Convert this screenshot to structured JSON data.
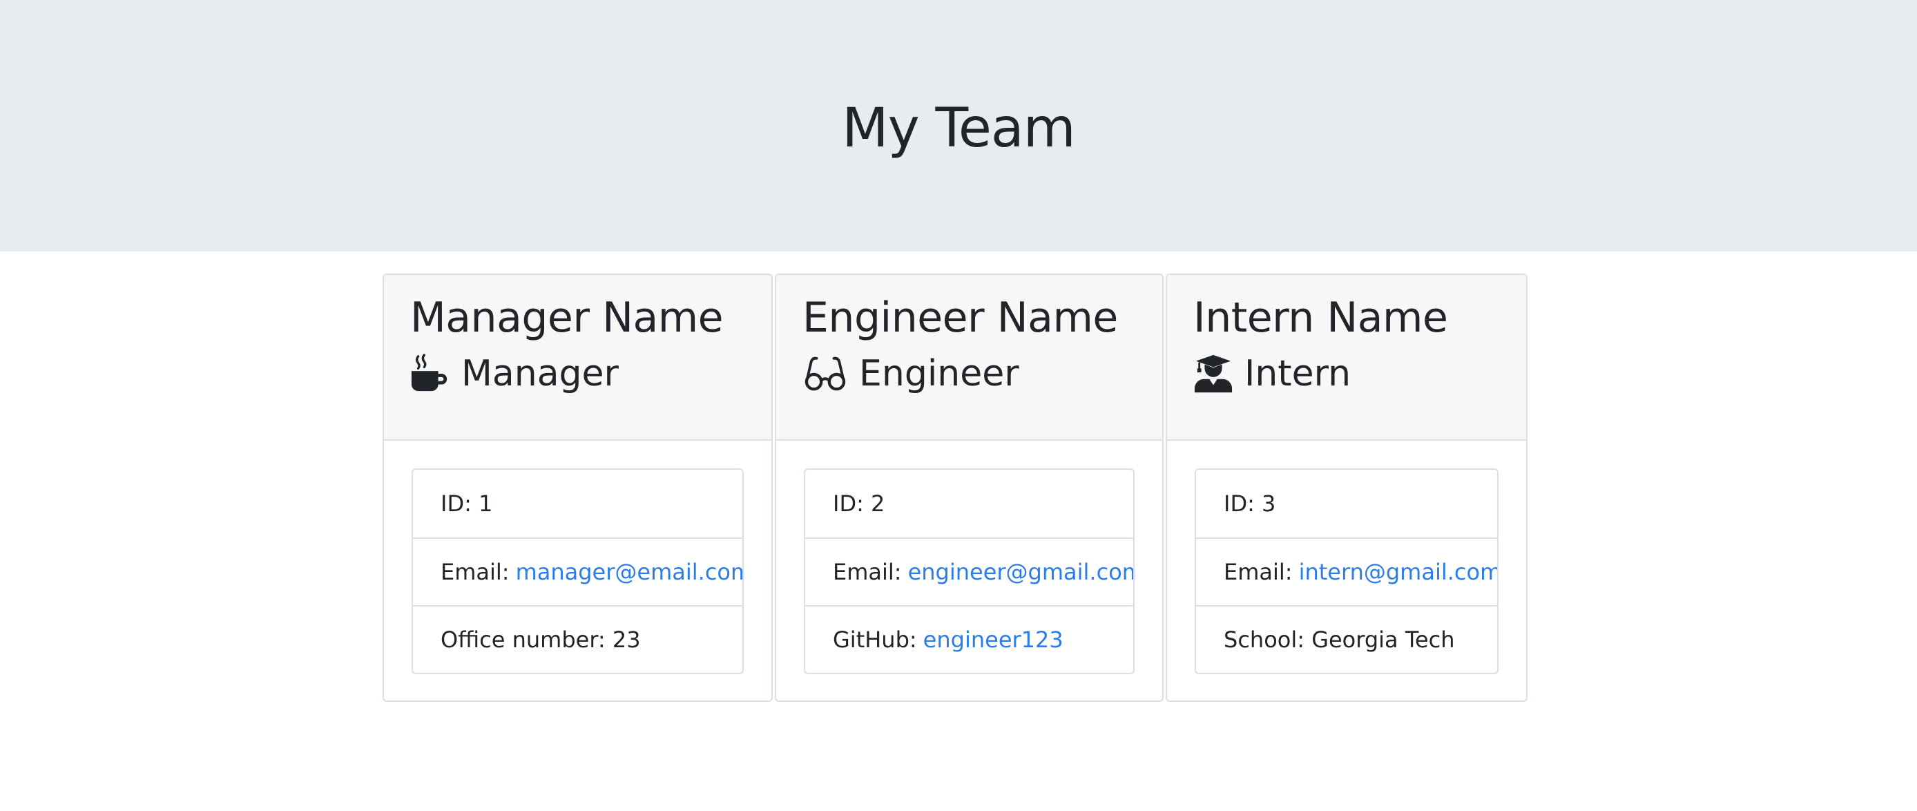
{
  "header": {
    "title": "My Team"
  },
  "cards": [
    {
      "name": "Manager Name",
      "role": "Manager",
      "icon": "coffee-mug-icon",
      "id_label": "ID:",
      "id_value": "1",
      "email_label": "Email:",
      "email": "manager@email.com",
      "extra_label": "Office number:",
      "extra_value": "23"
    },
    {
      "name": "Engineer Name",
      "role": "Engineer",
      "icon": "glasses-icon",
      "id_label": "ID:",
      "id_value": "2",
      "email_label": "Email:",
      "email": "engineer@gmail.com",
      "extra_label": "GitHub:",
      "extra_value": "engineer123"
    },
    {
      "name": "Intern Name",
      "role": "Intern",
      "icon": "graduate-icon",
      "id_label": "ID:",
      "id_value": "3",
      "email_label": "Email:",
      "email": "intern@gmail.com",
      "extra_label": "School:",
      "extra_value": "Georgia Tech"
    }
  ],
  "colors": {
    "link": "#2b7de9",
    "jumbotron": "#e9ecef",
    "card_header": "#f7f7f7",
    "text": "#212529"
  }
}
